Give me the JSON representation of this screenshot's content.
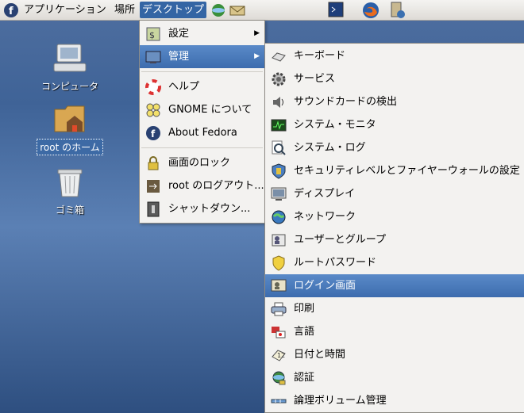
{
  "panel": {
    "applications": "アプリケーション",
    "places": "場所",
    "desktop": "デスクトップ"
  },
  "desktop_icons": {
    "computer": "コンピュータ",
    "home": "root のホーム",
    "trash": "ゴミ箱"
  },
  "desktop_menu": {
    "items": [
      "設定",
      "管理",
      "ヘルプ",
      "GNOME について",
      "About Fedora",
      "画面のロック",
      "root のログアウト...",
      "シャットダウン..."
    ]
  },
  "admin_menu": {
    "items": [
      "キーボード",
      "サービス",
      "サウンドカードの検出",
      "システム・モニタ",
      "システム・ログ",
      "セキュリティレベルとファイヤーウォールの設定",
      "ディスプレイ",
      "ネットワーク",
      "ユーザーとグループ",
      "ルートパスワード",
      "ログイン画面",
      "印刷",
      "言語",
      "日付と時間",
      "認証",
      "論理ボリューム管理"
    ]
  },
  "colors": {
    "highlight": "#3d6cae",
    "panel": "#e8e6e2",
    "desktop": "#4a6fa5"
  }
}
